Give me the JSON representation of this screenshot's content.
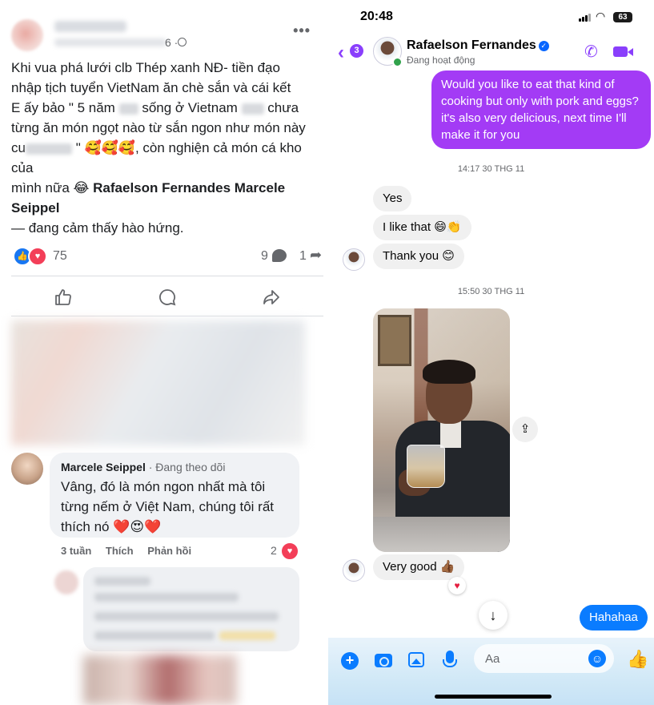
{
  "facebook_post": {
    "time": "6 ·",
    "body_lines": [
      "Khi vua phá lưới clb Thép xanh NĐ- tiền đạo",
      "nhập tịch tuyển VietNam ăn chè sắn và cái kết",
      "E ấy bảo \" 5 năm",
      "sống ở Vietnam",
      "chưa",
      "từng ăn món ngọt nào từ sắn ngon như món này",
      "cu",
      "\" 🥰🥰🥰, còn nghiện cả món cá kho của",
      "mình nữa 😂",
      "Rafaelson Fernandes Marcele Seippel"
    ],
    "feeling": "— đang cảm thấy hào hứng.",
    "reaction_count": "75",
    "comment_count": "9",
    "share_count": "1",
    "comment": {
      "author": "Marcele Seippel",
      "author_status": " · Đang theo dõi",
      "text": "Vâng, đó là món ngon nhất mà tôi từng nếm ở Việt Nam, chúng tôi rất thích nó ❤️😍❤️",
      "time": "3 tuần",
      "like_label": "Thích",
      "reply_label": "Phản hồi",
      "reaction_count": "2"
    }
  },
  "messenger": {
    "status_time": "20:48",
    "battery": "63",
    "back_badge": "3",
    "contact_name": "Rafaelson Fernandes",
    "contact_status": "Đang hoạt động",
    "messages": {
      "outgoing_1": "Would you like to eat that kind of cooking but only with pork and eggs? it's also very delicious, next time I'll make it for you",
      "timestamp_1": "14:17 30 THG 11",
      "incoming_1": "Yes",
      "incoming_2": "I like that 😄👏",
      "incoming_3": "Thank you 😊",
      "timestamp_2": "15:50 30 THG 11",
      "incoming_4": "Very good 👍🏾",
      "outgoing_2": "Hahahaa"
    },
    "composer_placeholder": "Aa"
  },
  "colors": {
    "messenger_purple": "#a33bf5",
    "messenger_blue": "#0a7cff",
    "facebook_blue": "#1877f2",
    "love_red": "#f33e58"
  }
}
